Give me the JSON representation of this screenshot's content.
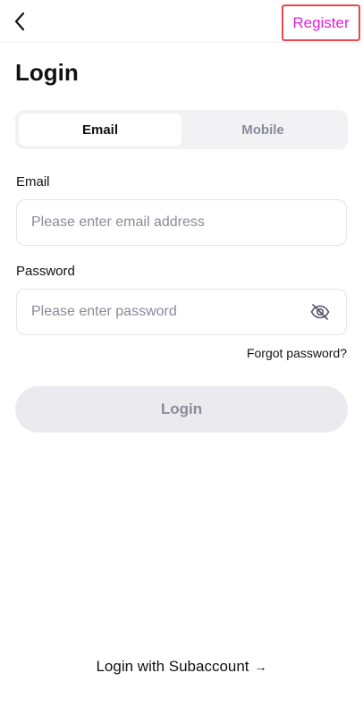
{
  "header": {
    "back_icon": "chevron-left-icon",
    "register_label": "Register"
  },
  "title": "Login",
  "tabs": [
    {
      "label": "Email",
      "active": true
    },
    {
      "label": "Mobile",
      "active": false
    }
  ],
  "email_field": {
    "label": "Email",
    "placeholder": "Please enter email address",
    "value": ""
  },
  "password_field": {
    "label": "Password",
    "placeholder": "Please enter password",
    "value": "",
    "visibility_icon": "eye-off-icon"
  },
  "forgot_password_label": "Forgot password?",
  "login_button_label": "Login",
  "subaccount": {
    "label": "Login with Subaccount",
    "arrow": "→"
  },
  "colors": {
    "register_text": "#e61fd6",
    "highlight_border": "#e5484d",
    "muted_text": "#8a8a99",
    "tab_track": "#f2f2f5",
    "disabled_button": "#ebebef"
  }
}
